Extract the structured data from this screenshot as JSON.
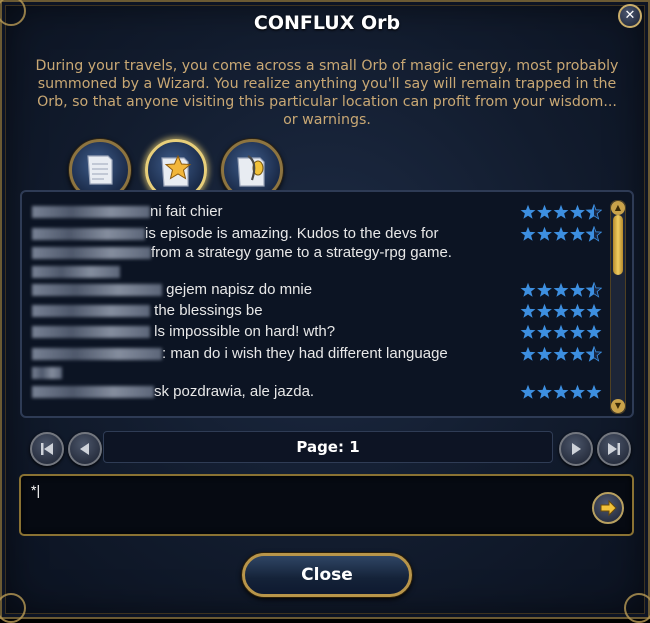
{
  "window": {
    "title": "CONFLUX Orb",
    "close_glyph": "✕"
  },
  "description": "During your travels, you come across a small Orb of magic energy, most probably summoned by a Wizard. You realize anything you'll say will remain trapped in the Orb, so that anyone visiting this particular location can profit from your wisdom... or warnings.",
  "tabs": [
    {
      "icon": "scroll-icon",
      "active": false
    },
    {
      "icon": "star-scroll-icon",
      "active": true
    },
    {
      "icon": "scroll-quill-icon",
      "active": false
    }
  ],
  "messages": [
    {
      "text": "ni fait chier",
      "rating": 4.5
    },
    {
      "text": "is episode is amazing. Kudos to the devs for",
      "text2": "from a strategy game to a strategy-rpg game.",
      "rating": 4.5
    },
    {
      "text": "gejem napisz do mnie",
      "rating": 4.5
    },
    {
      "text": "the blessings be",
      "rating": 5
    },
    {
      "text": "ls impossible on hard! wth?",
      "rating": 5
    },
    {
      "text": ": man do i wish they had different language",
      "rating": 4.5
    },
    {
      "text": "sk pozdrawia, ale jazda.",
      "rating": 5
    }
  ],
  "pagination": {
    "label": "Page: 1"
  },
  "input": {
    "value": "*|"
  },
  "buttons": {
    "close_label": "Close"
  },
  "colors": {
    "star": "#3d8fe0",
    "gold_border": "#b8954a",
    "description_text": "#c9a874"
  }
}
